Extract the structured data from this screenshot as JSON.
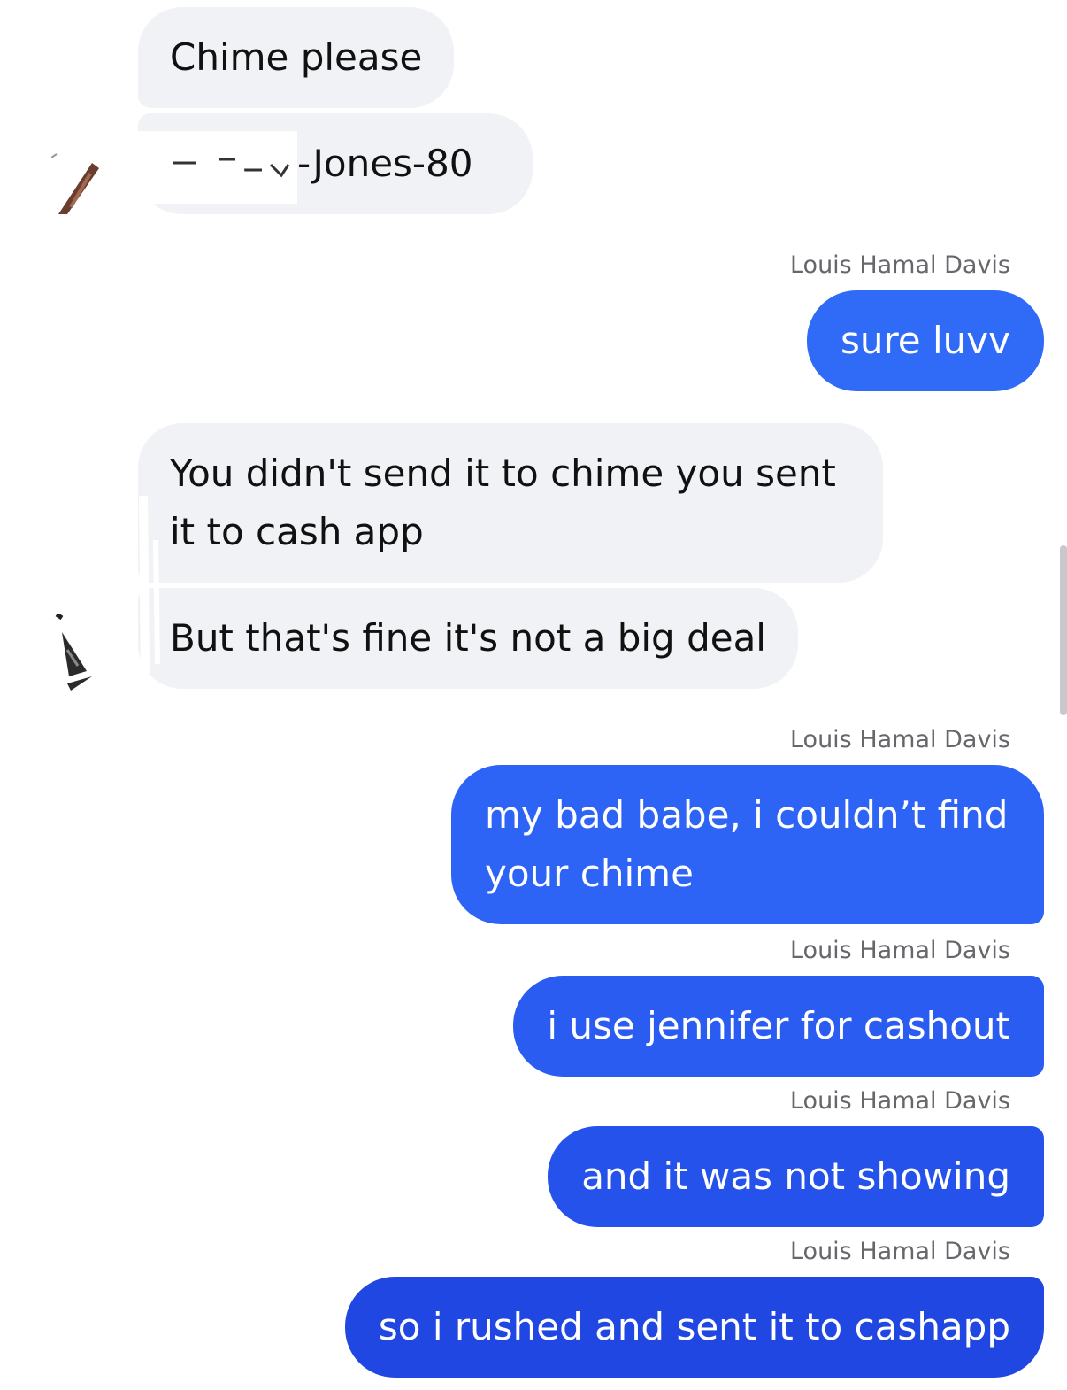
{
  "conversation": {
    "messages": [
      {
        "id": "m1",
        "direction": "incoming",
        "text": "Chime please"
      },
      {
        "id": "m2",
        "direction": "incoming",
        "text": "-Jones-80",
        "note_redacted_prefix": true
      },
      {
        "id": "m3",
        "direction": "outgoing",
        "sender": "Louis Hamal Davis",
        "text": "sure luvv"
      },
      {
        "id": "m4",
        "direction": "incoming",
        "lines": [
          "You didn't send it to chime you sent",
          "it to cash app"
        ]
      },
      {
        "id": "m5",
        "direction": "incoming",
        "text": "But that's fine it's not a big deal"
      },
      {
        "id": "m6",
        "direction": "outgoing",
        "sender": "Louis Hamal Davis",
        "lines": [
          "my bad babe, i couldn’t find",
          "your chime"
        ]
      },
      {
        "id": "m7",
        "direction": "outgoing",
        "sender": "Louis Hamal Davis",
        "text": "i use jennifer for cashout"
      },
      {
        "id": "m8",
        "direction": "outgoing",
        "sender": "Louis Hamal Davis",
        "text": "and it was not showing"
      },
      {
        "id": "m9",
        "direction": "outgoing",
        "sender": "Louis Hamal Davis",
        "text": "so i rushed and sent it to cashapp"
      }
    ]
  },
  "colors": {
    "incoming_bubble": "#f1f2f6",
    "outgoing_gradient_top": "#2f6bf7",
    "outgoing_gradient_bottom": "#1f44e0",
    "sender_text": "#65676b"
  }
}
